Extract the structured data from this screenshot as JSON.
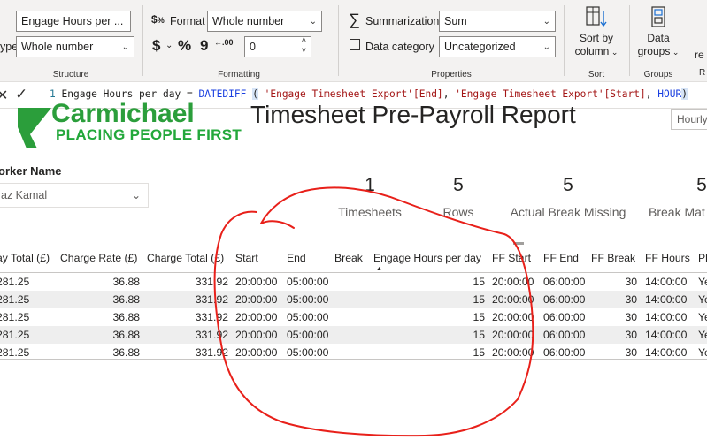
{
  "ribbon": {
    "structure": {
      "name_value": "Engage Hours per ...",
      "type_label": "ype",
      "type_value": "Whole number",
      "group_label": "Structure"
    },
    "formatting": {
      "format_label": "Format",
      "format_value": "Whole number",
      "currency_symbol": "$",
      "percent_symbol": "%",
      "comma_symbol": "9",
      "decimals_symbol": ".00",
      "decimals_value": "0",
      "group_label": "Formatting"
    },
    "properties": {
      "summarization_label": "Summarization",
      "summarization_value": "Sum",
      "data_category_label": "Data category",
      "data_category_value": "Uncategorized",
      "group_label": "Properties"
    },
    "sort": {
      "button_line1": "Sort by",
      "button_line2": "column",
      "group_label": "Sort"
    },
    "groups": {
      "button_line1": "Data",
      "button_line2": "groups",
      "group_label": "Groups"
    },
    "overflow": {
      "partial_text": "re",
      "partial_label": "R"
    }
  },
  "formula_bar": {
    "line_number": "1",
    "measure_name": "Engage Hours per day",
    "equals": "=",
    "func": "DATEDIFF",
    "open_paren": "(",
    "arg1": "'Engage Timesheet Export'[End]",
    "comma1": ",",
    "arg2": "'Engage Timesheet Export'[Start]",
    "comma2": ",",
    "arg3": "HOUR",
    "close_paren": ")"
  },
  "report": {
    "logo_word": "Carmichael",
    "tagline": "PLACING PEOPLE FIRST",
    "title": "Timesheet Pre-Payroll Report",
    "hourly_box": "Hourly"
  },
  "slicer": {
    "label": "orker Name",
    "value": "az Kamal"
  },
  "cards": [
    {
      "value": "1",
      "label": "Timesheets"
    },
    {
      "value": "5",
      "label": "Rows"
    },
    {
      "value": "5",
      "label": "Actual Break Missing"
    },
    {
      "value": "5",
      "label": "Break Mat"
    }
  ],
  "table": {
    "headers": [
      "ay Total (£)",
      "Charge Rate (£)",
      "Charge Total (£)",
      "Start",
      "End",
      "Break",
      "Engage Hours per day",
      "FF Start",
      "FF End",
      "FF Break",
      "FF Hours",
      "Pl"
    ],
    "rows": [
      [
        "281.25",
        "36.88",
        "331.92",
        "20:00:00",
        "05:00:00",
        "",
        "15",
        "20:00:00",
        "06:00:00",
        "30",
        "14:00:00",
        "Ye"
      ],
      [
        "281.25",
        "36.88",
        "331.92",
        "20:00:00",
        "05:00:00",
        "",
        "15",
        "20:00:00",
        "06:00:00",
        "30",
        "14:00:00",
        "Ye"
      ],
      [
        "281.25",
        "36.88",
        "331.92",
        "20:00:00",
        "05:00:00",
        "",
        "15",
        "20:00:00",
        "06:00:00",
        "30",
        "14:00:00",
        "Ye"
      ],
      [
        "281.25",
        "36.88",
        "331.92",
        "20:00:00",
        "05:00:00",
        "",
        "15",
        "20:00:00",
        "06:00:00",
        "30",
        "14:00:00",
        "Ye"
      ],
      [
        "281.25",
        "36.88",
        "331.92",
        "20:00:00",
        "05:00:00",
        "",
        "15",
        "20:00:00",
        "06:00:00",
        "30",
        "14:00:00",
        "Ye"
      ]
    ]
  },
  "colors": {
    "brand_green": "#2b9e3b",
    "annotation_red": "#e8201a",
    "dax_keyword": "#1a3fe0",
    "dax_string": "#a31515"
  }
}
